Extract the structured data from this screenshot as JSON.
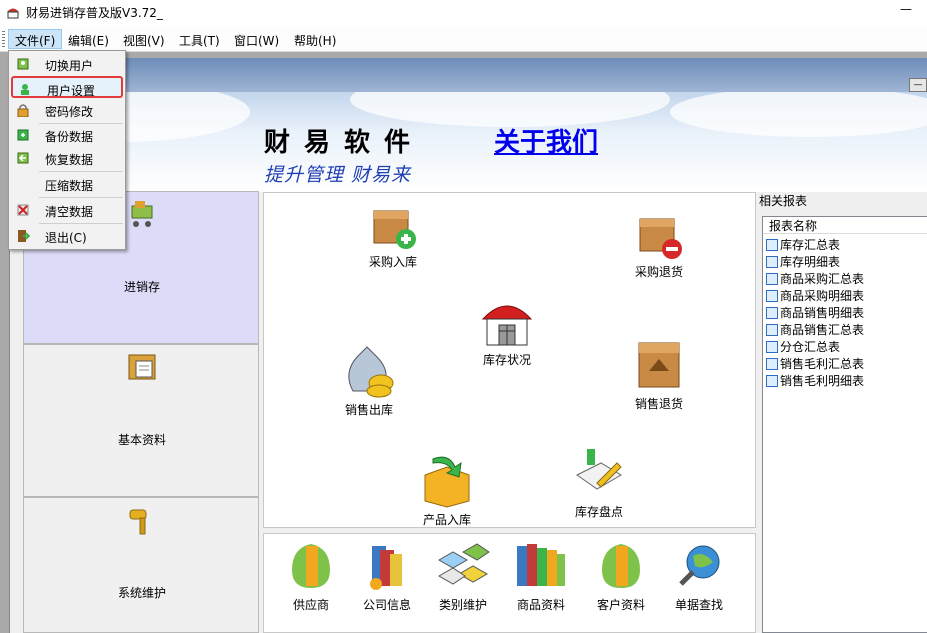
{
  "window": {
    "title": "财易进销存普及版V3.72_",
    "minimize_glyph": "—"
  },
  "menubar": {
    "items": [
      {
        "label": "文件(F)"
      },
      {
        "label": "编辑(E)"
      },
      {
        "label": "视图(V)"
      },
      {
        "label": "工具(T)"
      },
      {
        "label": "窗口(W)"
      },
      {
        "label": "帮助(H)"
      }
    ]
  },
  "file_menu": {
    "items": [
      {
        "label": "切换用户",
        "icon": "switch-user-icon"
      },
      {
        "label": "用户设置",
        "icon": "user-settings-icon"
      },
      {
        "label": "密码修改",
        "icon": "lock-icon"
      },
      {
        "label": "备份数据",
        "icon": "backup-icon"
      },
      {
        "label": "恢复数据",
        "icon": "restore-icon"
      },
      {
        "label": "压缩数据",
        "icon": ""
      },
      {
        "label": "清空数据",
        "icon": "clear-data-icon"
      },
      {
        "label": "退出(C)",
        "icon": "exit-icon"
      }
    ]
  },
  "banner": {
    "title": "财易软件",
    "about_link": "关于我们",
    "slogan": "提升管理 财易来"
  },
  "left_nav": {
    "sections": [
      {
        "label": "进销存",
        "icon": "shopping-cart-icon"
      },
      {
        "label": "基本资料",
        "icon": "document-folder-icon"
      },
      {
        "label": "系统维护",
        "icon": "gavel-icon"
      }
    ]
  },
  "workspace": {
    "items": [
      {
        "label": "采购入库",
        "icon": "purchase-in-box-icon"
      },
      {
        "label": "采购退货",
        "icon": "purchase-return-box-icon"
      },
      {
        "label": "库存状况",
        "icon": "warehouse-icon"
      },
      {
        "label": "销售出库",
        "icon": "money-bag-icon"
      },
      {
        "label": "销售退货",
        "icon": "sales-return-box-icon"
      },
      {
        "label": "产品入库",
        "icon": "product-in-box-icon"
      },
      {
        "label": "库存盘点",
        "icon": "inventory-check-icon"
      }
    ]
  },
  "bottom_toolbar": {
    "items": [
      {
        "label": "供应商",
        "icon": "supplier-icon"
      },
      {
        "label": "公司信息",
        "icon": "company-info-icon"
      },
      {
        "label": "类别维护",
        "icon": "category-icon"
      },
      {
        "label": "商品资料",
        "icon": "product-books-icon"
      },
      {
        "label": "客户资料",
        "icon": "customer-icon"
      },
      {
        "label": "单据查找",
        "icon": "search-globe-icon"
      }
    ]
  },
  "reports": {
    "title": "相关报表",
    "column_header": "报表名称",
    "items": [
      "库存汇总表",
      "库存明细表",
      "商品采购汇总表",
      "商品采购明细表",
      "商品销售明细表",
      "商品销售汇总表",
      "分仓汇总表",
      "销售毛利汇总表",
      "销售毛利明细表"
    ]
  }
}
